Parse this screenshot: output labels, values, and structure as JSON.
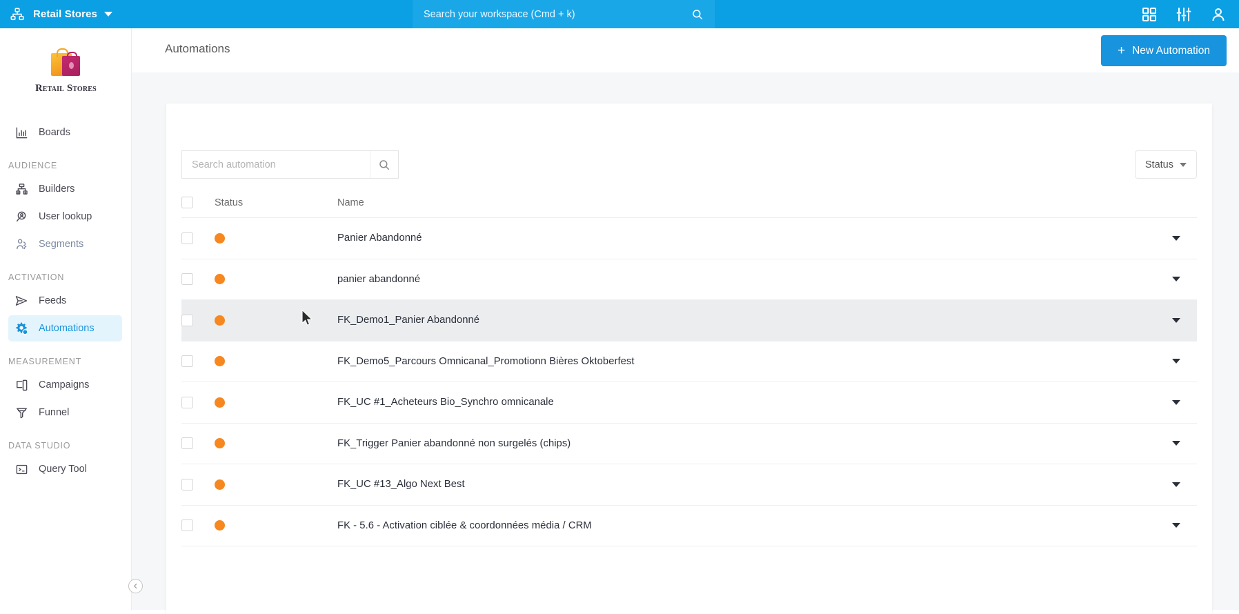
{
  "topbar": {
    "org_icon": "org-chart-icon",
    "org_name": "Retail Stores",
    "search_placeholder": "Search your workspace (Cmd + k)",
    "search_icon": "search-icon",
    "apps_icon": "grid-apps-icon",
    "settings_icon": "sliders-settings-icon",
    "account_icon": "user-account-icon"
  },
  "subheader": {
    "breadcrumb": "Automations",
    "new_automation_label": "New Automation",
    "plus": "+"
  },
  "sidebar": {
    "logo_text": "Retail Stores",
    "collapse_icon": "chevron-left-circle-icon",
    "groups": [
      {
        "label": "",
        "items": [
          {
            "label": "Boards",
            "icon": "bar-chart-icon",
            "active": false
          }
        ]
      },
      {
        "label": "AUDIENCE",
        "items": [
          {
            "label": "Builders",
            "icon": "builders-grid-icon",
            "active": false
          },
          {
            "label": "User lookup",
            "icon": "magnifier-person-icon",
            "active": false
          },
          {
            "label": "Segments",
            "icon": "people-segments-icon",
            "active": false
          }
        ]
      },
      {
        "label": "ACTIVATION",
        "items": [
          {
            "label": "Feeds",
            "icon": "paper-plane-icon",
            "active": false
          },
          {
            "label": "Automations",
            "icon": "gear-automation-icon",
            "active": true
          }
        ]
      },
      {
        "label": "MEASUREMENT",
        "items": [
          {
            "label": "Campaigns",
            "icon": "devices-campaign-icon",
            "active": false
          },
          {
            "label": "Funnel",
            "icon": "funnel-icon",
            "active": false
          }
        ]
      },
      {
        "label": "DATA STUDIO",
        "items": [
          {
            "label": "Query Tool",
            "icon": "terminal-console-icon",
            "active": false
          }
        ]
      }
    ]
  },
  "panel": {
    "search": {
      "placeholder": "Search automation",
      "value": "",
      "icon": "search-icon"
    },
    "status_filter": {
      "label": "Status",
      "icon": "chevron-down-icon"
    },
    "table": {
      "columns": [
        "",
        "Status",
        "Name"
      ],
      "header_checkbox": "select-all-checkbox",
      "rows": [
        {
          "status": "active",
          "name": "Panier Abandonné",
          "highlight": false
        },
        {
          "status": "active",
          "name": "panier abandonné",
          "highlight": false
        },
        {
          "status": "active",
          "name": "FK_Demo1_Panier Abandonné",
          "highlight": true
        },
        {
          "status": "active",
          "name": "FK_Demo5_Parcours Omnicanal_Promotionn Bières Oktoberfest",
          "highlight": false
        },
        {
          "status": "active",
          "name": "FK_UC #1_Acheteurs Bio_Synchro omnicanale",
          "highlight": false
        },
        {
          "status": "active",
          "name": "FK_Trigger Panier abandonné non surgelés (chips)",
          "highlight": false
        },
        {
          "status": "active",
          "name": "FK_UC #13_Algo Next Best",
          "highlight": false
        },
        {
          "status": "active",
          "name": "FK - 5.6 - Activation ciblée & coordonnées média / CRM",
          "highlight": false
        }
      ]
    }
  },
  "colors": {
    "brand_blue": "#0b9fe3",
    "button_blue": "#1893dd",
    "status_orange": "#f7871f",
    "active_nav_bg": "#e3f4fc",
    "active_nav_text": "#1893dd",
    "page_bg": "#f6f7f8"
  }
}
